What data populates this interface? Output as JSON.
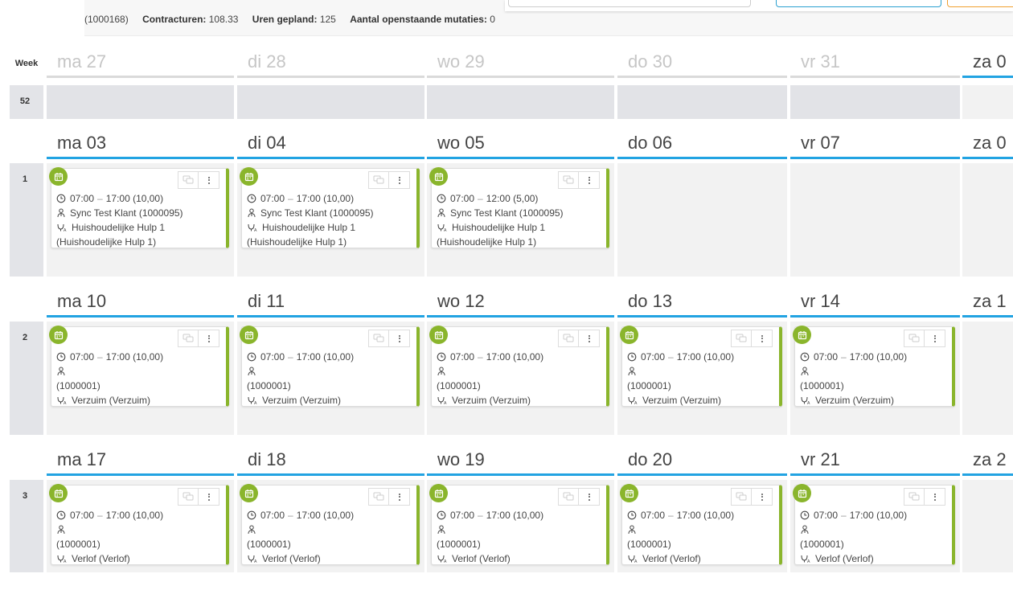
{
  "header": {
    "employee_id": "(1000168)",
    "contract_hours_label": "Contracturen:",
    "contract_hours_value": "108.33",
    "planned_hours_label": "Uren gepland:",
    "planned_hours_value": "125",
    "open_mutations_label": "Aantal openstaande mutaties:",
    "open_mutations_value": "0"
  },
  "calendar": {
    "week_column_label": "Week",
    "colors": {
      "accent": "#22a3e2",
      "event": "#8ab52c"
    },
    "weeks": [
      {
        "number": "52",
        "days": [
          {
            "label": "ma 27",
            "past": true,
            "event": null
          },
          {
            "label": "di 28",
            "past": true,
            "event": null
          },
          {
            "label": "wo 29",
            "past": true,
            "event": null
          },
          {
            "label": "do 30",
            "past": true,
            "event": null
          },
          {
            "label": "vr 31",
            "past": true,
            "event": null
          },
          {
            "label": "za 0",
            "past": false,
            "event": null
          }
        ]
      },
      {
        "number": "1",
        "days": [
          {
            "label": "ma 03",
            "past": false,
            "event": {
              "time": "07:00",
              "end": "17:00 (10,00)",
              "client": "Sync Test Klant (1000095)",
              "task": "Huishoudelijke Hulp 1",
              "task_detail": "(Huishoudelijke Hulp 1)"
            }
          },
          {
            "label": "di 04",
            "past": false,
            "event": {
              "time": "07:00",
              "end": "17:00 (10,00)",
              "client": "Sync Test Klant (1000095)",
              "task": "Huishoudelijke Hulp 1",
              "task_detail": "(Huishoudelijke Hulp 1)"
            }
          },
          {
            "label": "wo 05",
            "past": false,
            "event": {
              "time": "07:00",
              "end": "12:00 (5,00)",
              "client": "Sync Test Klant (1000095)",
              "task": "Huishoudelijke Hulp 1",
              "task_detail": "(Huishoudelijke Hulp 1)"
            }
          },
          {
            "label": "do 06",
            "past": false,
            "event": null
          },
          {
            "label": "vr 07",
            "past": false,
            "event": null
          },
          {
            "label": "za 0",
            "past": false,
            "event": null
          }
        ]
      },
      {
        "number": "2",
        "days": [
          {
            "label": "ma 10",
            "past": false,
            "event": {
              "time": "07:00",
              "end": "17:00 (10,00)",
              "client": "",
              "client_id": "(1000001)",
              "task": "Verzuim (Verzuim)"
            }
          },
          {
            "label": "di 11",
            "past": false,
            "event": {
              "time": "07:00",
              "end": "17:00 (10,00)",
              "client": "",
              "client_id": "(1000001)",
              "task": "Verzuim (Verzuim)"
            }
          },
          {
            "label": "wo 12",
            "past": false,
            "event": {
              "time": "07:00",
              "end": "17:00 (10,00)",
              "client": "",
              "client_id": "(1000001)",
              "task": "Verzuim (Verzuim)"
            }
          },
          {
            "label": "do 13",
            "past": false,
            "event": {
              "time": "07:00",
              "end": "17:00 (10,00)",
              "client": "",
              "client_id": "(1000001)",
              "task": "Verzuim (Verzuim)"
            }
          },
          {
            "label": "vr 14",
            "past": false,
            "event": {
              "time": "07:00",
              "end": "17:00 (10,00)",
              "client": "",
              "client_id": "(1000001)",
              "task": "Verzuim (Verzuim)"
            }
          },
          {
            "label": "za 1",
            "past": false,
            "event": null
          }
        ]
      },
      {
        "number": "3",
        "days": [
          {
            "label": "ma 17",
            "past": false,
            "event": {
              "time": "07:00",
              "end": "17:00 (10,00)",
              "client": "",
              "client_id": "(1000001)",
              "task": "Verlof (Verlof)"
            }
          },
          {
            "label": "di 18",
            "past": false,
            "event": {
              "time": "07:00",
              "end": "17:00 (10,00)",
              "client": "",
              "client_id": "(1000001)",
              "task": "Verlof (Verlof)"
            }
          },
          {
            "label": "wo 19",
            "past": false,
            "event": {
              "time": "07:00",
              "end": "17:00 (10,00)",
              "client": "",
              "client_id": "(1000001)",
              "task": "Verlof (Verlof)"
            }
          },
          {
            "label": "do 20",
            "past": false,
            "event": {
              "time": "07:00",
              "end": "17:00 (10,00)",
              "client": "",
              "client_id": "(1000001)",
              "task": "Verlof (Verlof)"
            }
          },
          {
            "label": "vr 21",
            "past": false,
            "event": {
              "time": "07:00",
              "end": "17:00 (10,00)",
              "client": "",
              "client_id": "(1000001)",
              "task": "Verlof (Verlof)"
            }
          },
          {
            "label": "za 2",
            "past": false,
            "event": null
          }
        ]
      }
    ]
  }
}
